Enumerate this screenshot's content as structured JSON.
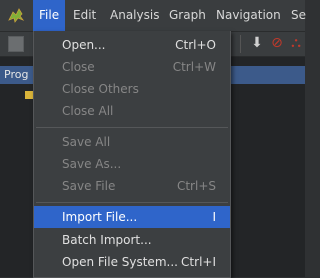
{
  "menubar": {
    "items": [
      {
        "label": "File",
        "active": true
      },
      {
        "label": "Edit"
      },
      {
        "label": "Analysis"
      },
      {
        "label": "Graph"
      },
      {
        "label": "Navigation"
      },
      {
        "label": "Se"
      }
    ]
  },
  "panel": {
    "header": "Prog"
  },
  "file_menu": {
    "groups": [
      [
        {
          "label": "Open...",
          "shortcut": "Ctrl+O",
          "enabled": true
        },
        {
          "label": "Close",
          "shortcut": "Ctrl+W",
          "enabled": false
        },
        {
          "label": "Close Others",
          "shortcut": "",
          "enabled": false
        },
        {
          "label": "Close All",
          "shortcut": "",
          "enabled": false
        }
      ],
      [
        {
          "label": "Save All",
          "shortcut": "",
          "enabled": false
        },
        {
          "label": "Save As...",
          "shortcut": "",
          "enabled": false
        },
        {
          "label": "Save File",
          "shortcut": "Ctrl+S",
          "enabled": false
        }
      ],
      [
        {
          "label": "Import File...",
          "shortcut": "I",
          "enabled": true,
          "highlighted": true
        },
        {
          "label": "Batch Import...",
          "shortcut": "",
          "enabled": true
        },
        {
          "label": "Open File System...",
          "shortcut": "Ctrl+I",
          "enabled": true
        }
      ]
    ]
  },
  "colors": {
    "accent": "#2f65ca",
    "menu_bg": "#3c3f41",
    "disabled_text": "#868686"
  }
}
